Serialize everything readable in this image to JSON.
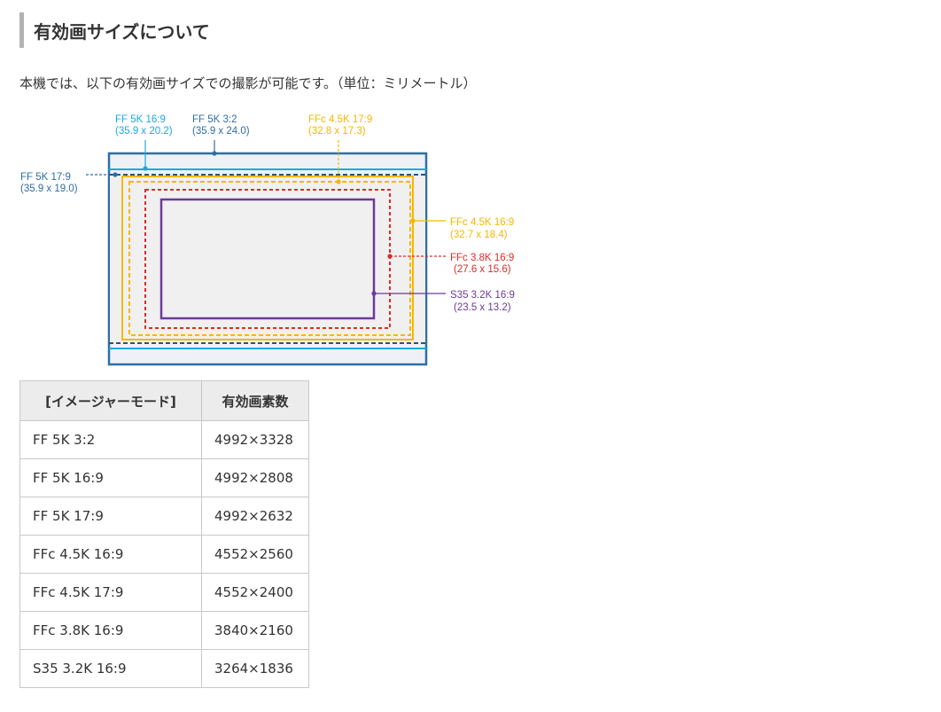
{
  "page": {
    "heading": "有効画サイズについて",
    "intro": "本機では、以下の有効画サイズでの撮影が可能です。（単位：ミリメートル）"
  },
  "diagram": {
    "labels": {
      "ff5k169_name": "FF 5K 16:9",
      "ff5k169_dims": "(35.9 x 20.2)",
      "ff5k32_name": "FF 5K 3:2",
      "ff5k32_dims": "(35.9 x 24.0)",
      "ffc45k179_name": "FFc 4.5K 17:9",
      "ffc45k179_dims": "(32.8 x 17.3)",
      "ff5k179_name": "FF 5K 17:9",
      "ff5k179_dims": "(35.9 x 19.0)",
      "ffc45k169_name": "FFc 4.5K 16:9",
      "ffc45k169_dims": "(32.7 x 18.4)",
      "ffc38k169_name": "FFc 3.8K 16:9",
      "ffc38k169_dims": "(27.6 x 15.6)",
      "s3532k169_name": "S35 3.2K 16:9",
      "s3532k169_dims": "(23.5 x 13.2)"
    },
    "colors": {
      "ff5k32": "#2e6ea6",
      "ff5k169": "#1ba9e1",
      "ff5k179": "#36516a",
      "ffc45k": "#f5b800",
      "ffc38k": "#e02a2a",
      "s35": "#6b3a9a",
      "fill": "#eef2f6",
      "inner_fill": "#f0f0f0"
    }
  },
  "table": {
    "headers": [
      "[イメージャーモード]",
      "有効画素数"
    ],
    "rows": [
      {
        "mode": "FF 5K 3:2",
        "pixels": "4992×3328"
      },
      {
        "mode": "FF 5K 16:9",
        "pixels": "4992×2808"
      },
      {
        "mode": "FF 5K 17:9",
        "pixels": "4992×2632"
      },
      {
        "mode": "FFc 4.5K 16:9",
        "pixels": "4552×2560"
      },
      {
        "mode": "FFc 4.5K 17:9",
        "pixels": "4552×2400"
      },
      {
        "mode": "FFc 3.8K 16:9",
        "pixels": "3840×2160"
      },
      {
        "mode": "S35 3.2K 16:9",
        "pixels": "3264×1836"
      }
    ]
  }
}
